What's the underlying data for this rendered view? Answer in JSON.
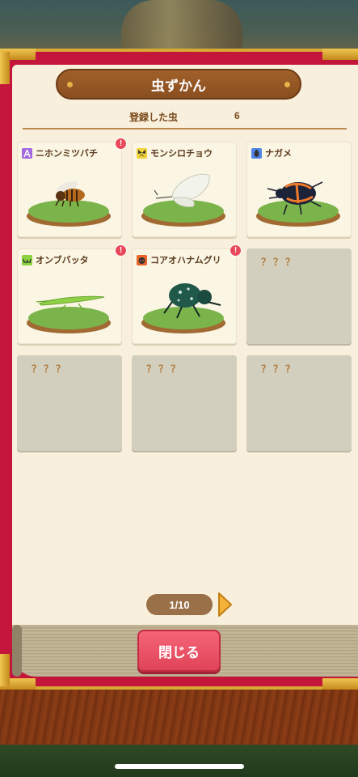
{
  "title": "虫ずかん",
  "registered": {
    "label": "登録した虫",
    "count": "6"
  },
  "unknown_label": "？？？",
  "badge_text": "!",
  "cards": [
    {
      "name": "ニホンミツバチ",
      "icon": "bee-type-icon",
      "icon_color": "#a36ae0",
      "new": true
    },
    {
      "name": "モンシロチョウ",
      "icon": "butterfly-type-icon",
      "icon_color": "#f3d23a",
      "new": false
    },
    {
      "name": "ナガメ",
      "icon": "beetle-type-icon",
      "icon_color": "#4f86e8",
      "new": false
    },
    {
      "name": "オンブバッタ",
      "icon": "grasshopper-type-icon",
      "icon_color": "#8ad23e",
      "new": true
    },
    {
      "name": "コアオハナムグリ",
      "icon": "ladybug-type-icon",
      "icon_color": "#e8662a",
      "new": true
    }
  ],
  "pager": {
    "page": "1/10"
  },
  "close_label": "閉じる",
  "colors": {
    "frame": "#c4163a",
    "page": "#f8efdc",
    "banner": "#8a4f20",
    "close": "#e04458",
    "badge": "#e8485a"
  }
}
